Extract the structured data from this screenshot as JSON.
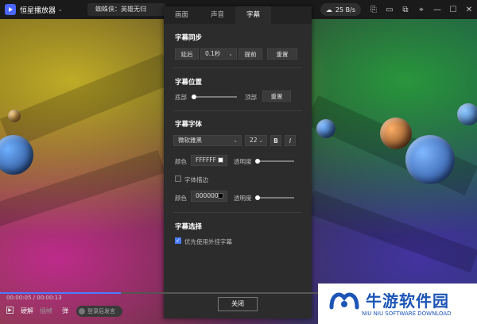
{
  "titlebar": {
    "app_name": "恒星播放器",
    "tab_title": "蜘蛛侠：英雄无归",
    "speed": "25 B/s",
    "icons": [
      "logo-icon",
      "chevron-down-icon",
      "cloud-download-icon",
      "share-icon",
      "subtitle-icon",
      "screen-icon",
      "pin-icon",
      "minimize-icon",
      "maximize-icon",
      "close-icon"
    ]
  },
  "dialog": {
    "tabs": [
      {
        "label": "画面"
      },
      {
        "label": "声音"
      },
      {
        "label": "字幕"
      }
    ],
    "active_tab": "字幕",
    "sync": {
      "title": "字幕同步",
      "delay_label": "延后",
      "step_value": "0.1秒",
      "advance_label": "提前",
      "reset_label": "重置"
    },
    "position": {
      "title": "字幕位置",
      "bottom_label": "底部",
      "top_label": "顶部",
      "reset_label": "重置",
      "value": 0.0
    },
    "font": {
      "title": "字幕字体",
      "family": "微软雅黑",
      "size": "22",
      "bold_label": "B",
      "italic_label": "I",
      "color_label": "颜色",
      "color_value": "FFFFFF",
      "opacity_label": "透明度",
      "outline_label": "字体描边",
      "outline_color_label": "颜色",
      "outline_color_value": "000000",
      "outline_opacity_label": "透明度",
      "outline_checked": false
    },
    "select": {
      "title": "字幕选择",
      "prefer_external_label": "优先使用外挂字幕",
      "prefer_external_checked": true
    },
    "close_label": "关闭"
  },
  "player": {
    "time": "00:00:05 / 00:00:13",
    "progress": 0.38,
    "hd_label": "硬解",
    "plugin_label": "插帧",
    "danmaku_label": "弹",
    "danmaku_placeholder": "登录后发言"
  },
  "watermark": {
    "title": "牛游软件园",
    "subtitle": "NIU NIU SOFTWARE DOWNLOAD"
  },
  "colors": {
    "accent": "#4a7cff",
    "dialog_bg": "#2c2c2c",
    "watermark_blue": "#1c55b6"
  }
}
